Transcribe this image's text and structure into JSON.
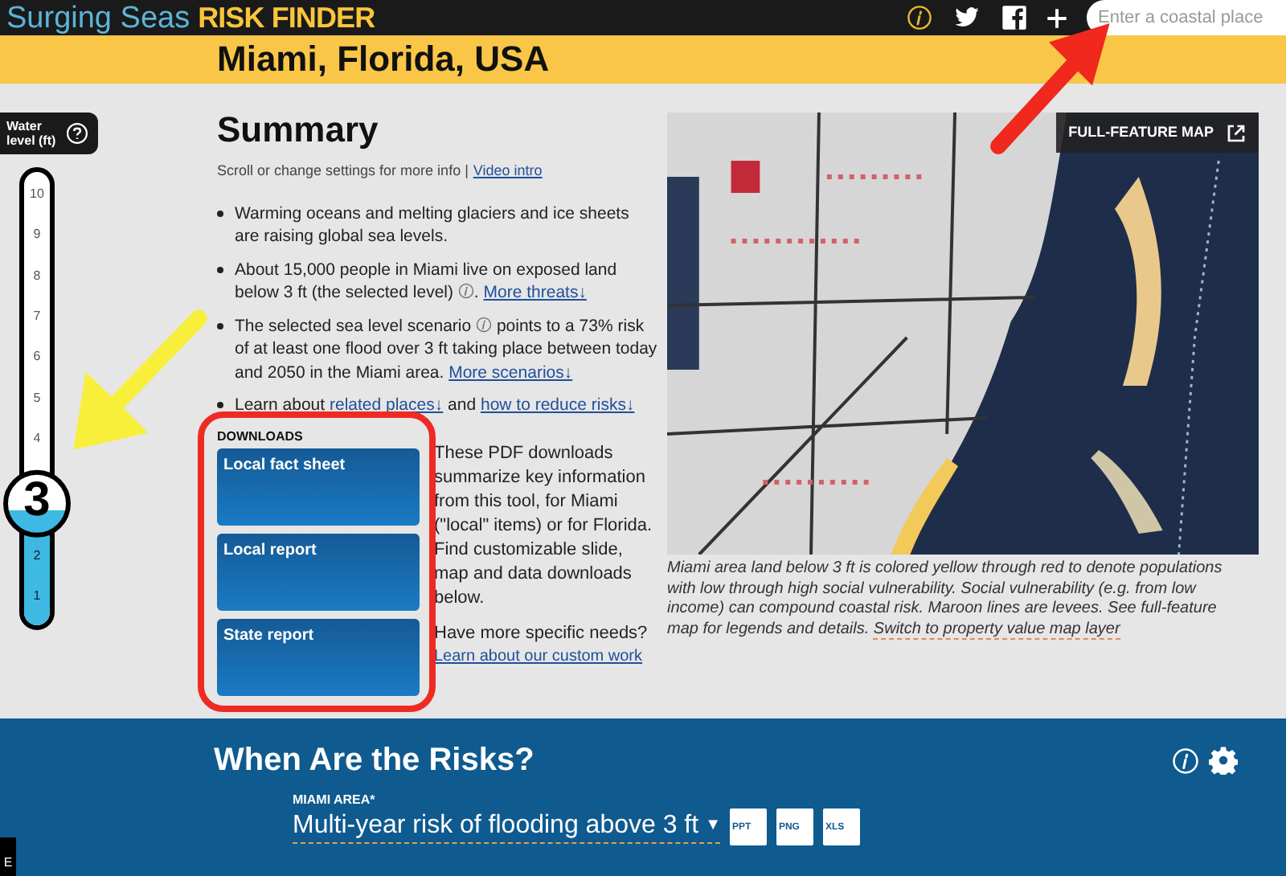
{
  "header": {
    "logo_primary": "Surging Seas",
    "logo_secondary": "RISK FINDER",
    "search": {
      "placeholder": "Enter a coastal place"
    }
  },
  "location_title": "Miami, Florida, USA",
  "water_level": {
    "label": "Water level (ft)",
    "ticks_above": [
      "10",
      "9",
      "8",
      "7",
      "6",
      "5",
      "4"
    ],
    "value": "3",
    "ticks_below": [
      "2",
      "1"
    ],
    "level": 0.23
  },
  "summary": {
    "title": "Summary",
    "subtitle": "Scroll or change settings for more info |",
    "subtitle_link": "Video intro",
    "bullets": [
      [
        {
          "kind": "text",
          "text": "Warming oceans and melting glaciers and ice sheets are raising global sea levels."
        }
      ],
      [
        {
          "kind": "text",
          "text": "About 15,000 people in Miami live on exposed land below 3 ft (the selected level)"
        },
        {
          "kind": "info"
        },
        {
          "kind": "text",
          "text": "."
        },
        {
          "kind": "link",
          "text": "More threats↓"
        }
      ],
      [
        {
          "kind": "text",
          "text": "The selected sea level scenario"
        },
        {
          "kind": "info"
        },
        {
          "kind": "text",
          "text": "points to a 73% risk of at least one flood over 3 ft taking place between today and 2050 in the Miami area."
        },
        {
          "kind": "link",
          "text": "More scenarios↓"
        }
      ],
      [
        {
          "kind": "text",
          "text": "Learn about"
        },
        {
          "kind": "link",
          "text": "related places↓"
        },
        {
          "kind": "text",
          "text": "and"
        },
        {
          "kind": "link",
          "text": "how to reduce risks↓"
        }
      ]
    ]
  },
  "downloads": {
    "label": "DOWNLOADS",
    "buttons": [
      "Local fact sheet",
      "Local report",
      "State report"
    ],
    "description": "These PDF downloads summarize key information from this tool, for Miami (\"local\" items) or for Florida. Find customizable slide, map and data downloads below.",
    "question": "Have more specific needs?",
    "link": "Learn about our custom work"
  },
  "map": {
    "kind": "picture",
    "button": "FULL-FEATURE MAP",
    "caption": "Miami area land below 3 ft is colored yellow through red to denote populations with low through high social vulnerability. Social vulnerability (e.g. from low income) can compound coastal risk. Maroon lines are levees. See full-feature map for legends and details.",
    "caption_link": "Switch to property value map layer"
  },
  "risks": {
    "title": "When Are the Risks?",
    "area_label": "MIAMI AREA*",
    "selector": "Multi-year risk of flooding above 3 ft",
    "caret": "▼",
    "exports": [
      "PPT",
      "PNG",
      "XLS"
    ]
  },
  "side_tab": "E"
}
